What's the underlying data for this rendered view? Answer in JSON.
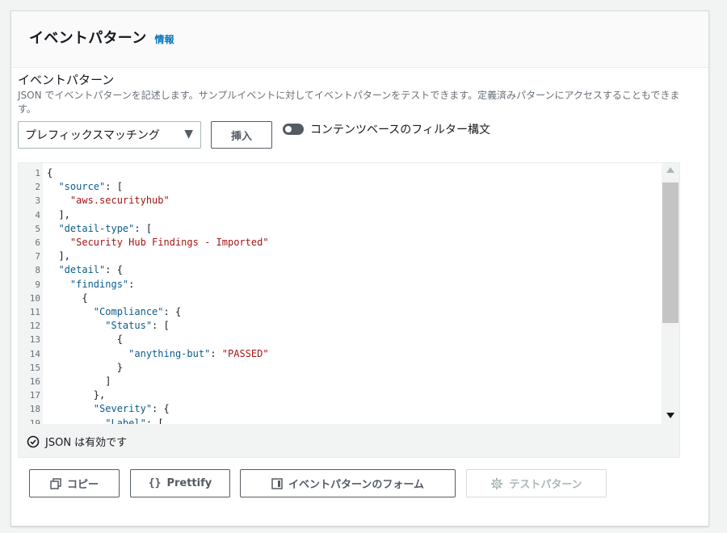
{
  "header": {
    "title": "イベントパターン",
    "info_link": "情報"
  },
  "field": {
    "label": "イベントパターン",
    "description": "JSON でイベントパターンを記述します。サンプルイベントに対してイベントパターンをテストできます。定義済みパターンにアクセスすることもできます。"
  },
  "controls": {
    "select_value": "プレフィックスマッチング",
    "insert_label": "挿入",
    "toggle_label": "コンテンツベースのフィルター構文",
    "toggle_on": false
  },
  "editor": {
    "lines": [
      {
        "n": "1",
        "text": "{"
      },
      {
        "n": "2",
        "text": "  \"source\": ["
      },
      {
        "n": "3",
        "text": "    \"aws.securityhub\""
      },
      {
        "n": "4",
        "text": "  ],"
      },
      {
        "n": "5",
        "text": "  \"detail-type\": ["
      },
      {
        "n": "6",
        "text": "    \"Security Hub Findings - Imported\""
      },
      {
        "n": "7",
        "text": "  ],"
      },
      {
        "n": "8",
        "text": "  \"detail\": {"
      },
      {
        "n": "9",
        "text": "    \"findings\":"
      },
      {
        "n": "10",
        "text": "      {"
      },
      {
        "n": "11",
        "text": "        \"Compliance\": {"
      },
      {
        "n": "12",
        "text": "          \"Status\": ["
      },
      {
        "n": "13",
        "text": "            {"
      },
      {
        "n": "14",
        "text": "              \"anything-but\": \"PASSED\""
      },
      {
        "n": "15",
        "text": "            }"
      },
      {
        "n": "16",
        "text": "          ]"
      },
      {
        "n": "17",
        "text": "        },"
      },
      {
        "n": "18",
        "text": "        \"Severity\": {"
      },
      {
        "n": "19",
        "text": "          \"Label\": ["
      }
    ],
    "status": "JSON は有効です"
  },
  "buttons": {
    "copy": "コピー",
    "prettify": "Prettify",
    "form": "イベントパターンのフォーム",
    "test": "テストパターン"
  },
  "colors": {
    "link": "#0073bb",
    "json_key": "#0a5b8a",
    "json_string": "#a31515",
    "disabled": "#aab7b8"
  }
}
